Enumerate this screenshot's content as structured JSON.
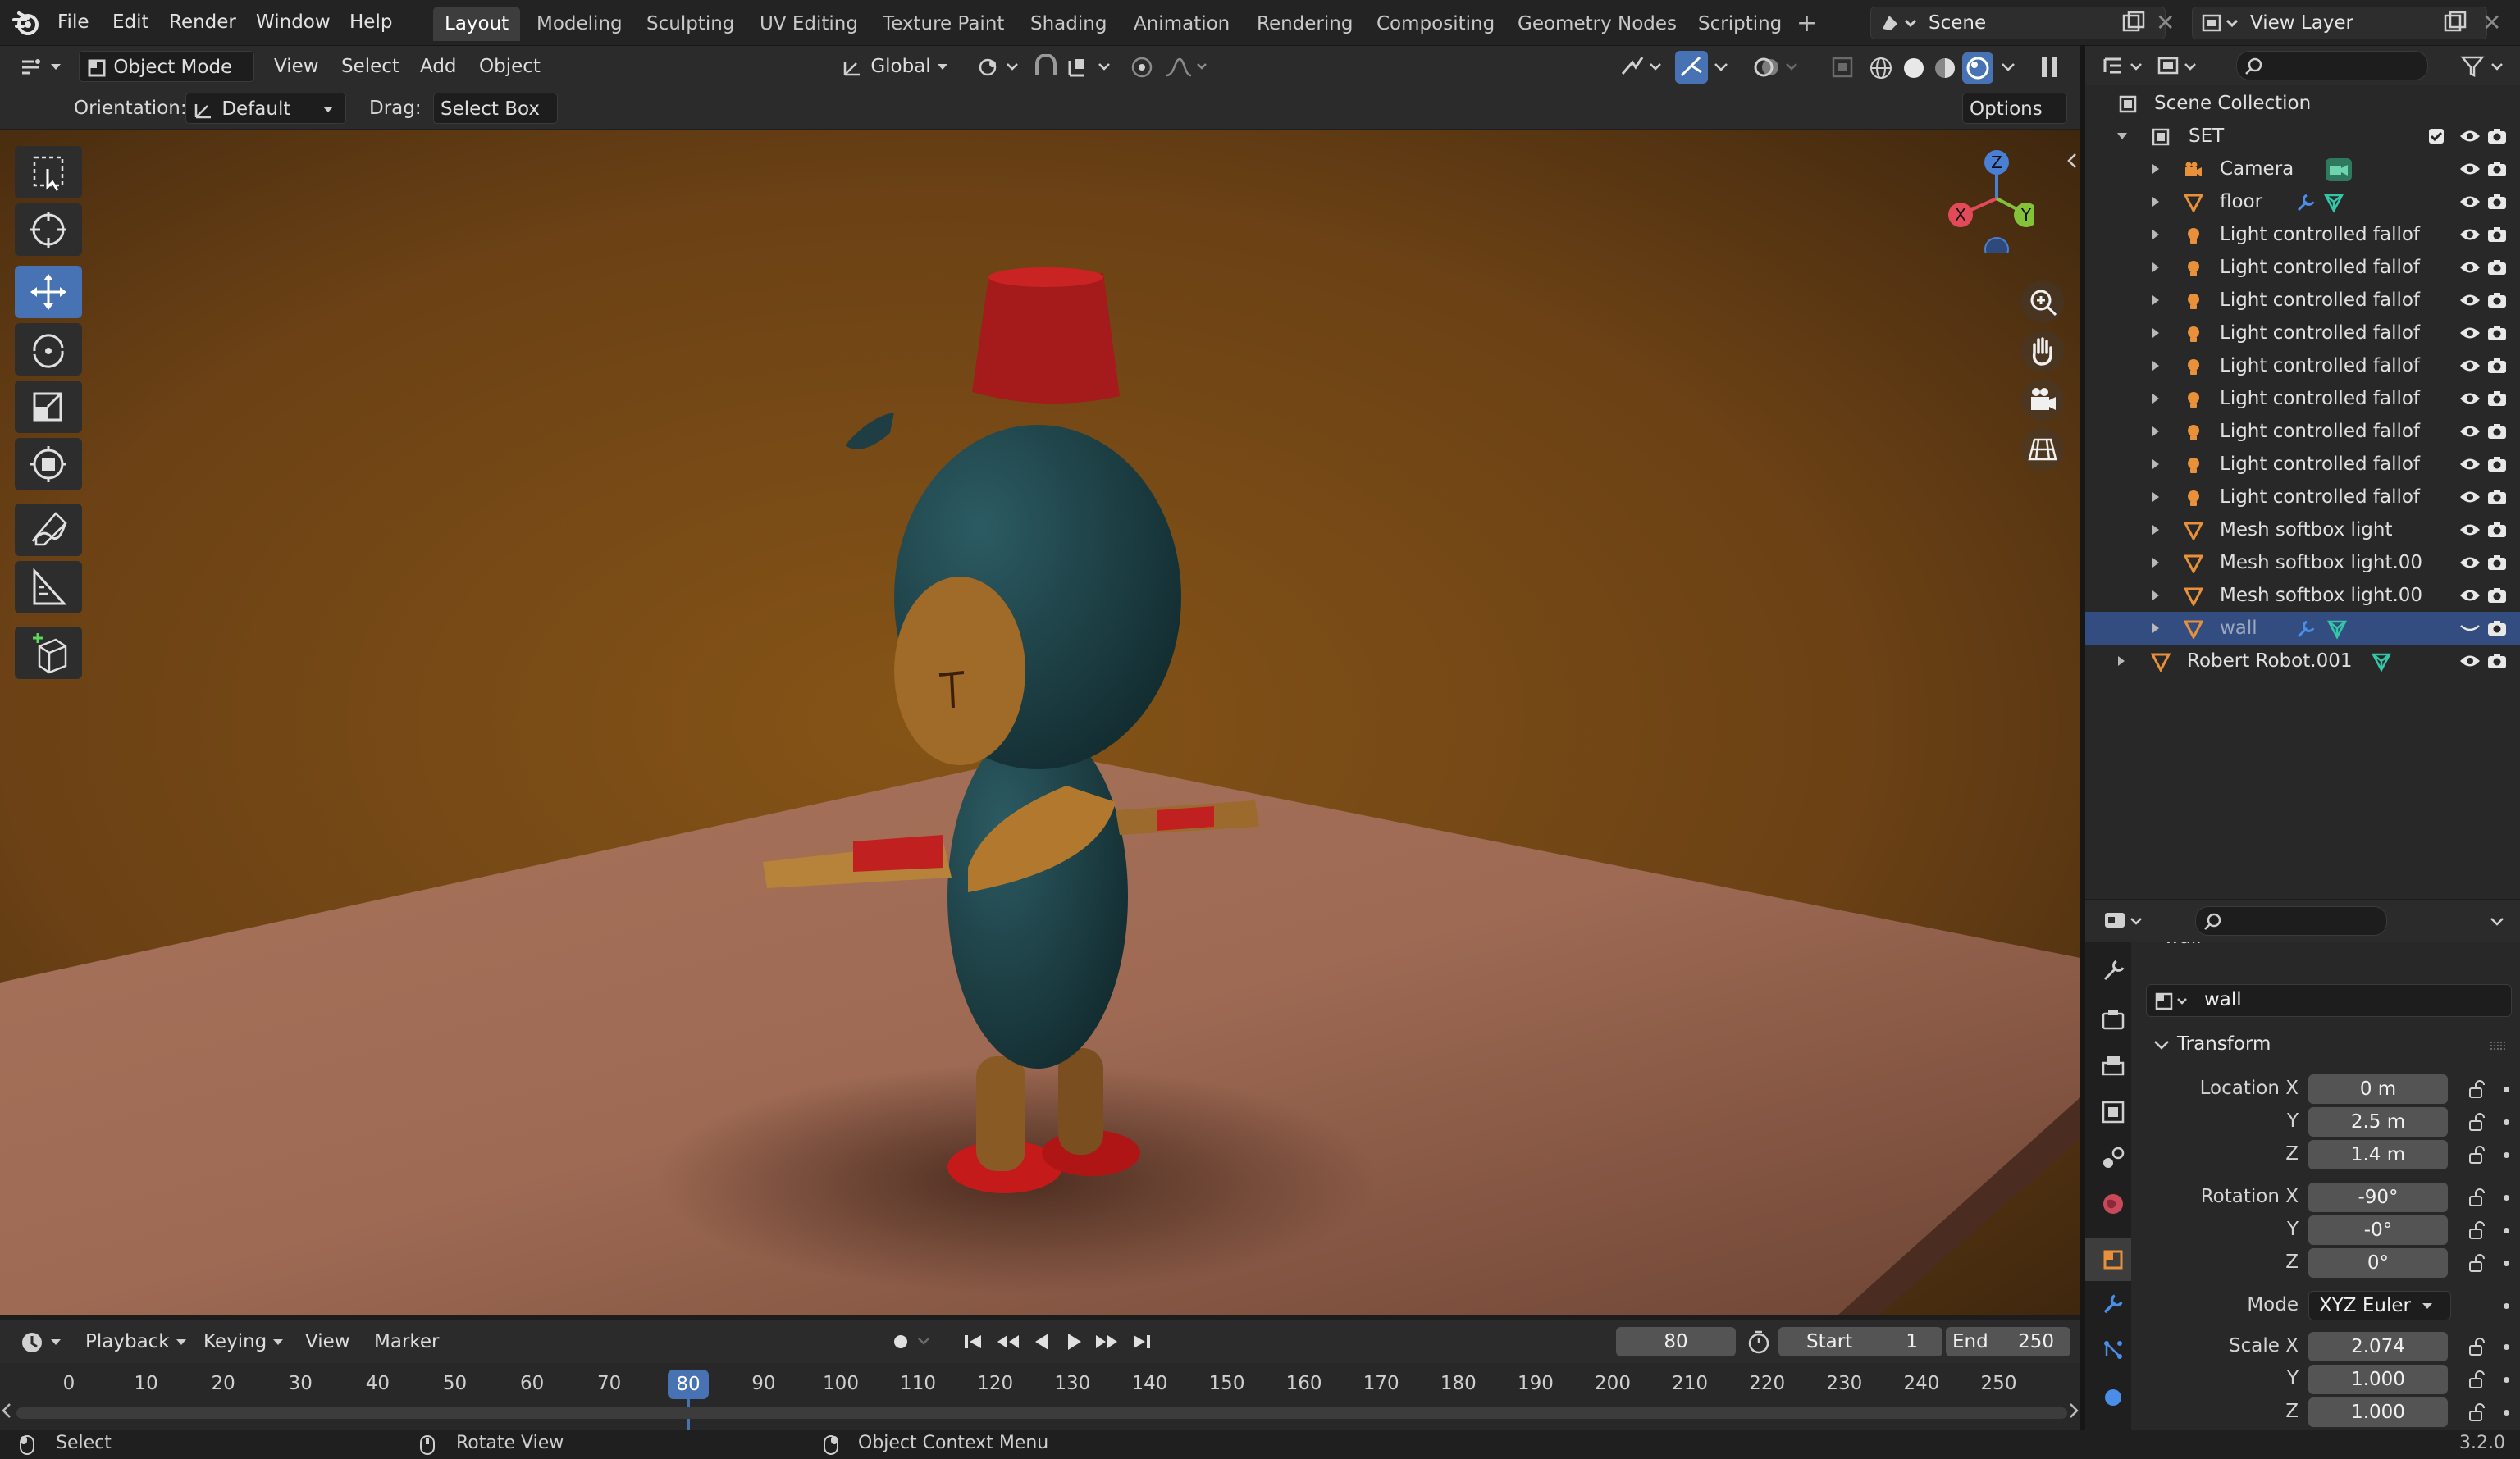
{
  "menubar": {
    "items": [
      "File",
      "Edit",
      "Render",
      "Window",
      "Help"
    ],
    "workspaces": [
      "Layout",
      "Modeling",
      "Sculpting",
      "UV Editing",
      "Texture Paint",
      "Shading",
      "Animation",
      "Rendering",
      "Compositing",
      "Geometry Nodes",
      "Scripting"
    ],
    "active_workspace": "Layout",
    "scene": "Scene",
    "view_layer": "View Layer"
  },
  "viewport_header": {
    "mode": "Object Mode",
    "menus": [
      "View",
      "Select",
      "Add",
      "Object"
    ],
    "transform_orientation": "Global"
  },
  "tool_settings": {
    "orientation_label": "Orientation:",
    "orientation_value": "Default",
    "drag_label": "Drag:",
    "drag_value": "Select Box",
    "options_label": "Options"
  },
  "gizmo": {
    "z": "Z",
    "x": "X",
    "y": "Y"
  },
  "timeline": {
    "menus": [
      "Playback",
      "Keying",
      "View",
      "Marker"
    ],
    "current_frame": "80",
    "start_label": "Start",
    "start_value": "1",
    "end_label": "End",
    "end_value": "250",
    "ticks": [
      "0",
      "10",
      "20",
      "30",
      "40",
      "50",
      "60",
      "70",
      "80",
      "90",
      "100",
      "110",
      "120",
      "130",
      "140",
      "150",
      "160",
      "170",
      "180",
      "190",
      "200",
      "210",
      "220",
      "230",
      "240",
      "250"
    ]
  },
  "statusbar": {
    "select": "Select",
    "rotate": "Rotate View",
    "context": "Object Context Menu",
    "version": "3.2.0"
  },
  "outliner": {
    "root": "Scene Collection",
    "collection": "SET",
    "items": [
      {
        "label": "Camera",
        "icon": "camera-icon"
      },
      {
        "label": "floor",
        "icon": "mesh-icon"
      },
      {
        "label": "Light controlled fallof",
        "icon": "light-icon"
      },
      {
        "label": "Light controlled fallof",
        "icon": "light-icon"
      },
      {
        "label": "Light controlled fallof",
        "icon": "light-icon"
      },
      {
        "label": "Light controlled fallof",
        "icon": "light-icon"
      },
      {
        "label": "Light controlled fallof",
        "icon": "light-icon"
      },
      {
        "label": "Light controlled fallof",
        "icon": "light-icon"
      },
      {
        "label": "Light controlled fallof",
        "icon": "light-icon"
      },
      {
        "label": "Light controlled fallof",
        "icon": "light-icon"
      },
      {
        "label": "Light controlled fallof",
        "icon": "light-icon"
      },
      {
        "label": "Mesh softbox light",
        "icon": "mesh-icon"
      },
      {
        "label": "Mesh softbox light.00",
        "icon": "mesh-icon"
      },
      {
        "label": "Mesh softbox light.00",
        "icon": "mesh-icon"
      },
      {
        "label": "wall",
        "icon": "mesh-icon"
      }
    ],
    "root_object": "Robert Robot.001"
  },
  "properties": {
    "object_name_header": "wall",
    "object_name": "wall",
    "panel_title": "Transform",
    "location_label": "Location X",
    "location": [
      "0 m",
      "2.5 m",
      "1.4 m"
    ],
    "rotation_label": "Rotation X",
    "rotation": [
      "-90°",
      "-0°",
      "0°"
    ],
    "mode_label": "Mode",
    "mode_value": "XYZ Euler",
    "scale_label": "Scale X",
    "scale": [
      "2.074",
      "1.000",
      "1.000"
    ],
    "axis_y": "Y",
    "axis_z": "Z"
  },
  "colors": {
    "accent": "#4772b3",
    "selection": "#334d80",
    "light_icon": "#e8913a",
    "mesh_icon": "#e8913a"
  }
}
